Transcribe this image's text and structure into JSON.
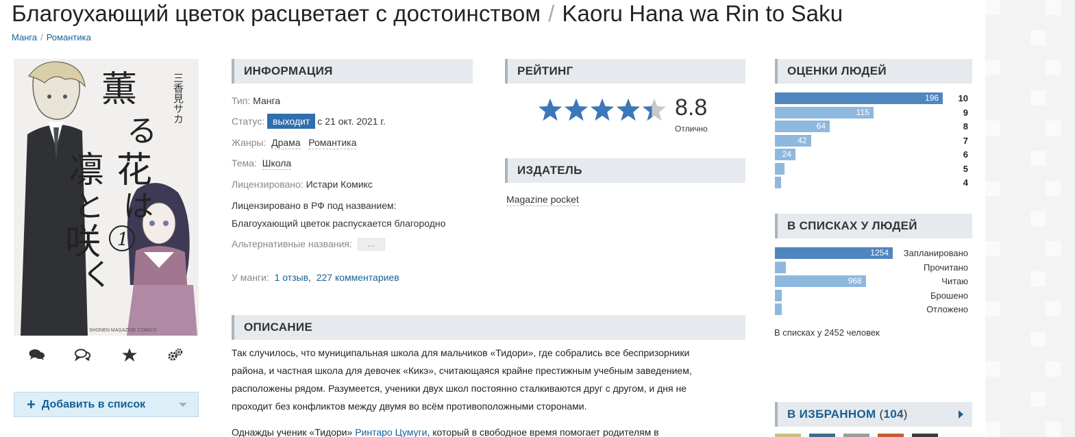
{
  "title": {
    "russian": "Благоухающий цветок расцветает с достоинством",
    "separator": "/",
    "romaji": "Kaoru Hana wa Rin to Saku"
  },
  "breadcrumbs": [
    "Манга",
    "Романтика"
  ],
  "cover": {
    "title_jp_line1": "薫る花は",
    "title_jp_line2": "凛と咲く",
    "author_jp": "三香見サカ",
    "volume": "1",
    "publisher_mark": "SHONEN MAGAZINE COMICS"
  },
  "icons": [
    "comments-icon",
    "chat-icon",
    "star-icon",
    "gears-icon"
  ],
  "add_to_list": "Добавить в список",
  "info": {
    "header": "ИНФОРМАЦИЯ",
    "type_key": "Тип:",
    "type_val": "Манга",
    "status_key": "Статус:",
    "status_badge": "выходит",
    "status_date": "с 21 окт. 2021 г.",
    "genres_key": "Жанры:",
    "genres": [
      "Драма",
      "Романтика"
    ],
    "theme_key": "Тема:",
    "theme": "Школа",
    "licensed_key": "Лицензировано:",
    "licensed_val": "Истари Комикс",
    "licensed_ru_key": "Лицензировано в РФ под названием:",
    "licensed_ru_val": "Благоухающий цветок распускается благородно",
    "alt_names_key": "Альтернативные названия:",
    "alt_names_btn": "…",
    "manga_has_key": "У манги:",
    "reviews": "1 отзыв",
    "comma": ",",
    "comments": "227 комментариев"
  },
  "rating": {
    "header": "РЕЙТИНГ",
    "score": "8.8",
    "score_label": "Отлично",
    "stars": 4.4
  },
  "publisher": {
    "header": "ИЗДАТЕЛЬ",
    "name": "Magazine pocket"
  },
  "description": {
    "header": "ОПИСАНИЕ",
    "paragraph1_lines": [
      "Так случилось, что муниципальная школа для мальчиков «Тидори», где собрались все беспризорники",
      "района, и частная школа для девочек «Кикэ», считающаяся крайне престижным учебным заведением,",
      "расположены рядом. Разумеется, ученики двух школ постоянно сталкиваются друг с другом, и дня не",
      "проходит без конфликтов между двумя во всём противоположными сторонами."
    ],
    "paragraph2_start": "Однажды ученик «Тидори»",
    "paragraph2_link": "Ринтаро Цумуги",
    "paragraph2_rest": ", который в свободное время помогает родителям в"
  },
  "user_scores": {
    "header": "ОЦЕНКИ ЛЮДЕЙ",
    "rows": [
      {
        "score": "10",
        "count": "196",
        "value": 196
      },
      {
        "score": "9",
        "count": "115",
        "value": 115
      },
      {
        "score": "8",
        "count": "64",
        "value": 64
      },
      {
        "score": "7",
        "count": "42",
        "value": 42
      },
      {
        "score": "6",
        "count": "24",
        "value": 24
      },
      {
        "score": "5",
        "count": "",
        "value": 11
      },
      {
        "score": "4",
        "count": "",
        "value": 7
      }
    ]
  },
  "user_lists": {
    "header": "В СПИСКАХ У ЛЮДЕЙ",
    "rows": [
      {
        "label": "Запланировано",
        "count": "1254",
        "value": 1254
      },
      {
        "label": "Прочитано",
        "count": "",
        "value": 120
      },
      {
        "label": "Читаю",
        "count": "968",
        "value": 968
      },
      {
        "label": "Брошено",
        "count": "",
        "value": 70
      },
      {
        "label": "Отложено",
        "count": "",
        "value": 70
      }
    ],
    "total": "В списках у 2452 человек"
  },
  "favorites": {
    "header": "В ИЗБРАННОМ",
    "open": "(",
    "count": "104",
    "close": ")"
  },
  "colors": {
    "accent": "#176093",
    "status_badge": "#2f6fac",
    "bar_top": "#4f86bf",
    "bar": "#8fb8de",
    "header_bg": "#e6e9ee"
  }
}
